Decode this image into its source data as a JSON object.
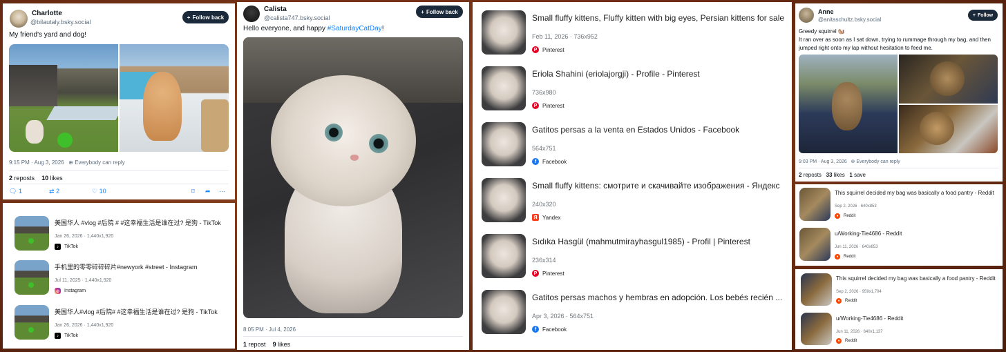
{
  "colors": {
    "page_bg": "#6e2e14",
    "follow_button": "#1b2a3a",
    "link": "#1083fe",
    "pinterest": "#e60023",
    "facebook": "#1877f2",
    "yandex": "#fc3f1d",
    "reddit": "#ff4500",
    "instagram": "#d6249f",
    "tiktok": "#000000"
  },
  "post1": {
    "name": "Charlotte",
    "handle": "@bilautaly.bsky.social",
    "follow": "Follow back",
    "text": "My friend's yard and dog!",
    "images": [
      "backyard-pool-dog-photo",
      "curly-dog-on-patio-photo"
    ],
    "time": "9:15 PM · Aug 3, 2026",
    "reply": "Everybody can reply",
    "reposts_count": "2",
    "reposts_label": "reposts",
    "likes_count": "10",
    "likes_label": "likes",
    "actions": {
      "reply": "1",
      "repost": "2",
      "like": "10"
    }
  },
  "results1": [
    {
      "title": "美国华人 #vlog #后院 # #这幸福生活是谁在过? 是狗 - TikTok",
      "meta": "Jan 26, 2026 · 1,440x1,920",
      "source": "TikTok",
      "icon": "tiktok-icon"
    },
    {
      "title": "手机里的零零碎碎碎片#newyork #street - Instagram",
      "meta": "Jul 11, 2025 · 1,440x1,920",
      "source": "Instagram",
      "icon": "instagram-icon"
    },
    {
      "title": "美国华人#vlog #后院# #这幸福生活是谁在过? 是狗 - TikTok",
      "meta": "Jan 26, 2026 · 1,440x1,920",
      "source": "TikTok",
      "icon": "tiktok-icon"
    }
  ],
  "post2": {
    "name": "Calista",
    "handle": "@calista747.bsky.social",
    "follow": "Follow back",
    "text_before": "Hello everyone, and happy ",
    "hashtag": "#SaturdayCatDay",
    "text_after": "!",
    "image": "fluffy-persian-kitten-photo",
    "time": "8:05 PM · Jul 4, 2026",
    "reposts_count": "1",
    "reposts_label": "repost",
    "likes_count": "9",
    "likes_label": "likes"
  },
  "results2": [
    {
      "title": "Small fluffy kittens, Fluffy kitten with big eyes, Persian kittens for sale",
      "meta": "Feb 11, 2026 · 736x952",
      "source": "Pinterest",
      "icon": "pinterest-icon"
    },
    {
      "title": "Eriola Shahini (eriolajorgji) - Profile - Pinterest",
      "meta": "736x980",
      "source": "Pinterest",
      "icon": "pinterest-icon"
    },
    {
      "title": "Gatitos persas a la venta en Estados Unidos - Facebook",
      "meta": "564x751",
      "source": "Facebook",
      "icon": "facebook-icon"
    },
    {
      "title": "Small fluffy kittens: смотрите и скачивайте изображения - Яндекс",
      "meta": "240x320",
      "source": "Yandex",
      "icon": "yandex-icon"
    },
    {
      "title": "Sıdıka Hasgül (mahmutmirayhasgul1985) - Profil | Pinterest",
      "meta": "236x314",
      "source": "Pinterest",
      "icon": "pinterest-icon"
    },
    {
      "title": "Gatitos persas machos y hembras en adopción. Los bebés recién ...",
      "meta": "Apr 3, 2026 · 564x751",
      "source": "Facebook",
      "icon": "facebook-icon"
    }
  ],
  "post3": {
    "name": "Anne",
    "handle": "@anitaschultz.bsky.social",
    "follow": "Follow",
    "text": "Greedy squirrel 🐿️\nIt ran over as soon as I sat down, trying to rummage through my bag, and then jumped right onto my lap without hesitation to feed me.",
    "images": [
      "squirrel-on-lap-photo",
      "squirrel-closeup-photo",
      "squirrel-on-bag-photo"
    ],
    "time": "9:03 PM · Aug 3, 2026",
    "reply": "Everybody can reply",
    "reposts_count": "2",
    "reposts_label": "reposts",
    "likes_count": "33",
    "likes_label": "likes",
    "saves_count": "1",
    "saves_label": "save"
  },
  "results3": [
    {
      "title": "This squirrel decided my bag was basically a food pantry - Reddit",
      "meta": "Sep 2, 2026 · 640x853",
      "source": "Reddit",
      "icon": "reddit-icon"
    },
    {
      "title": "u/Working-Tie4686 - Reddit",
      "meta": "Jun 11, 2026 · 640x853",
      "source": "Reddit",
      "icon": "reddit-icon"
    }
  ],
  "results4": [
    {
      "title": "This squirrel decided my bag was basically a food pantry - Reddit",
      "meta": "Sep 2, 2026 · 959x1,704",
      "source": "Reddit",
      "icon": "reddit-icon"
    },
    {
      "title": "u/Working-Tie4686 - Reddit",
      "meta": "Jun 11, 2026 · 640x1,137",
      "source": "Reddit",
      "icon": "reddit-icon"
    }
  ]
}
